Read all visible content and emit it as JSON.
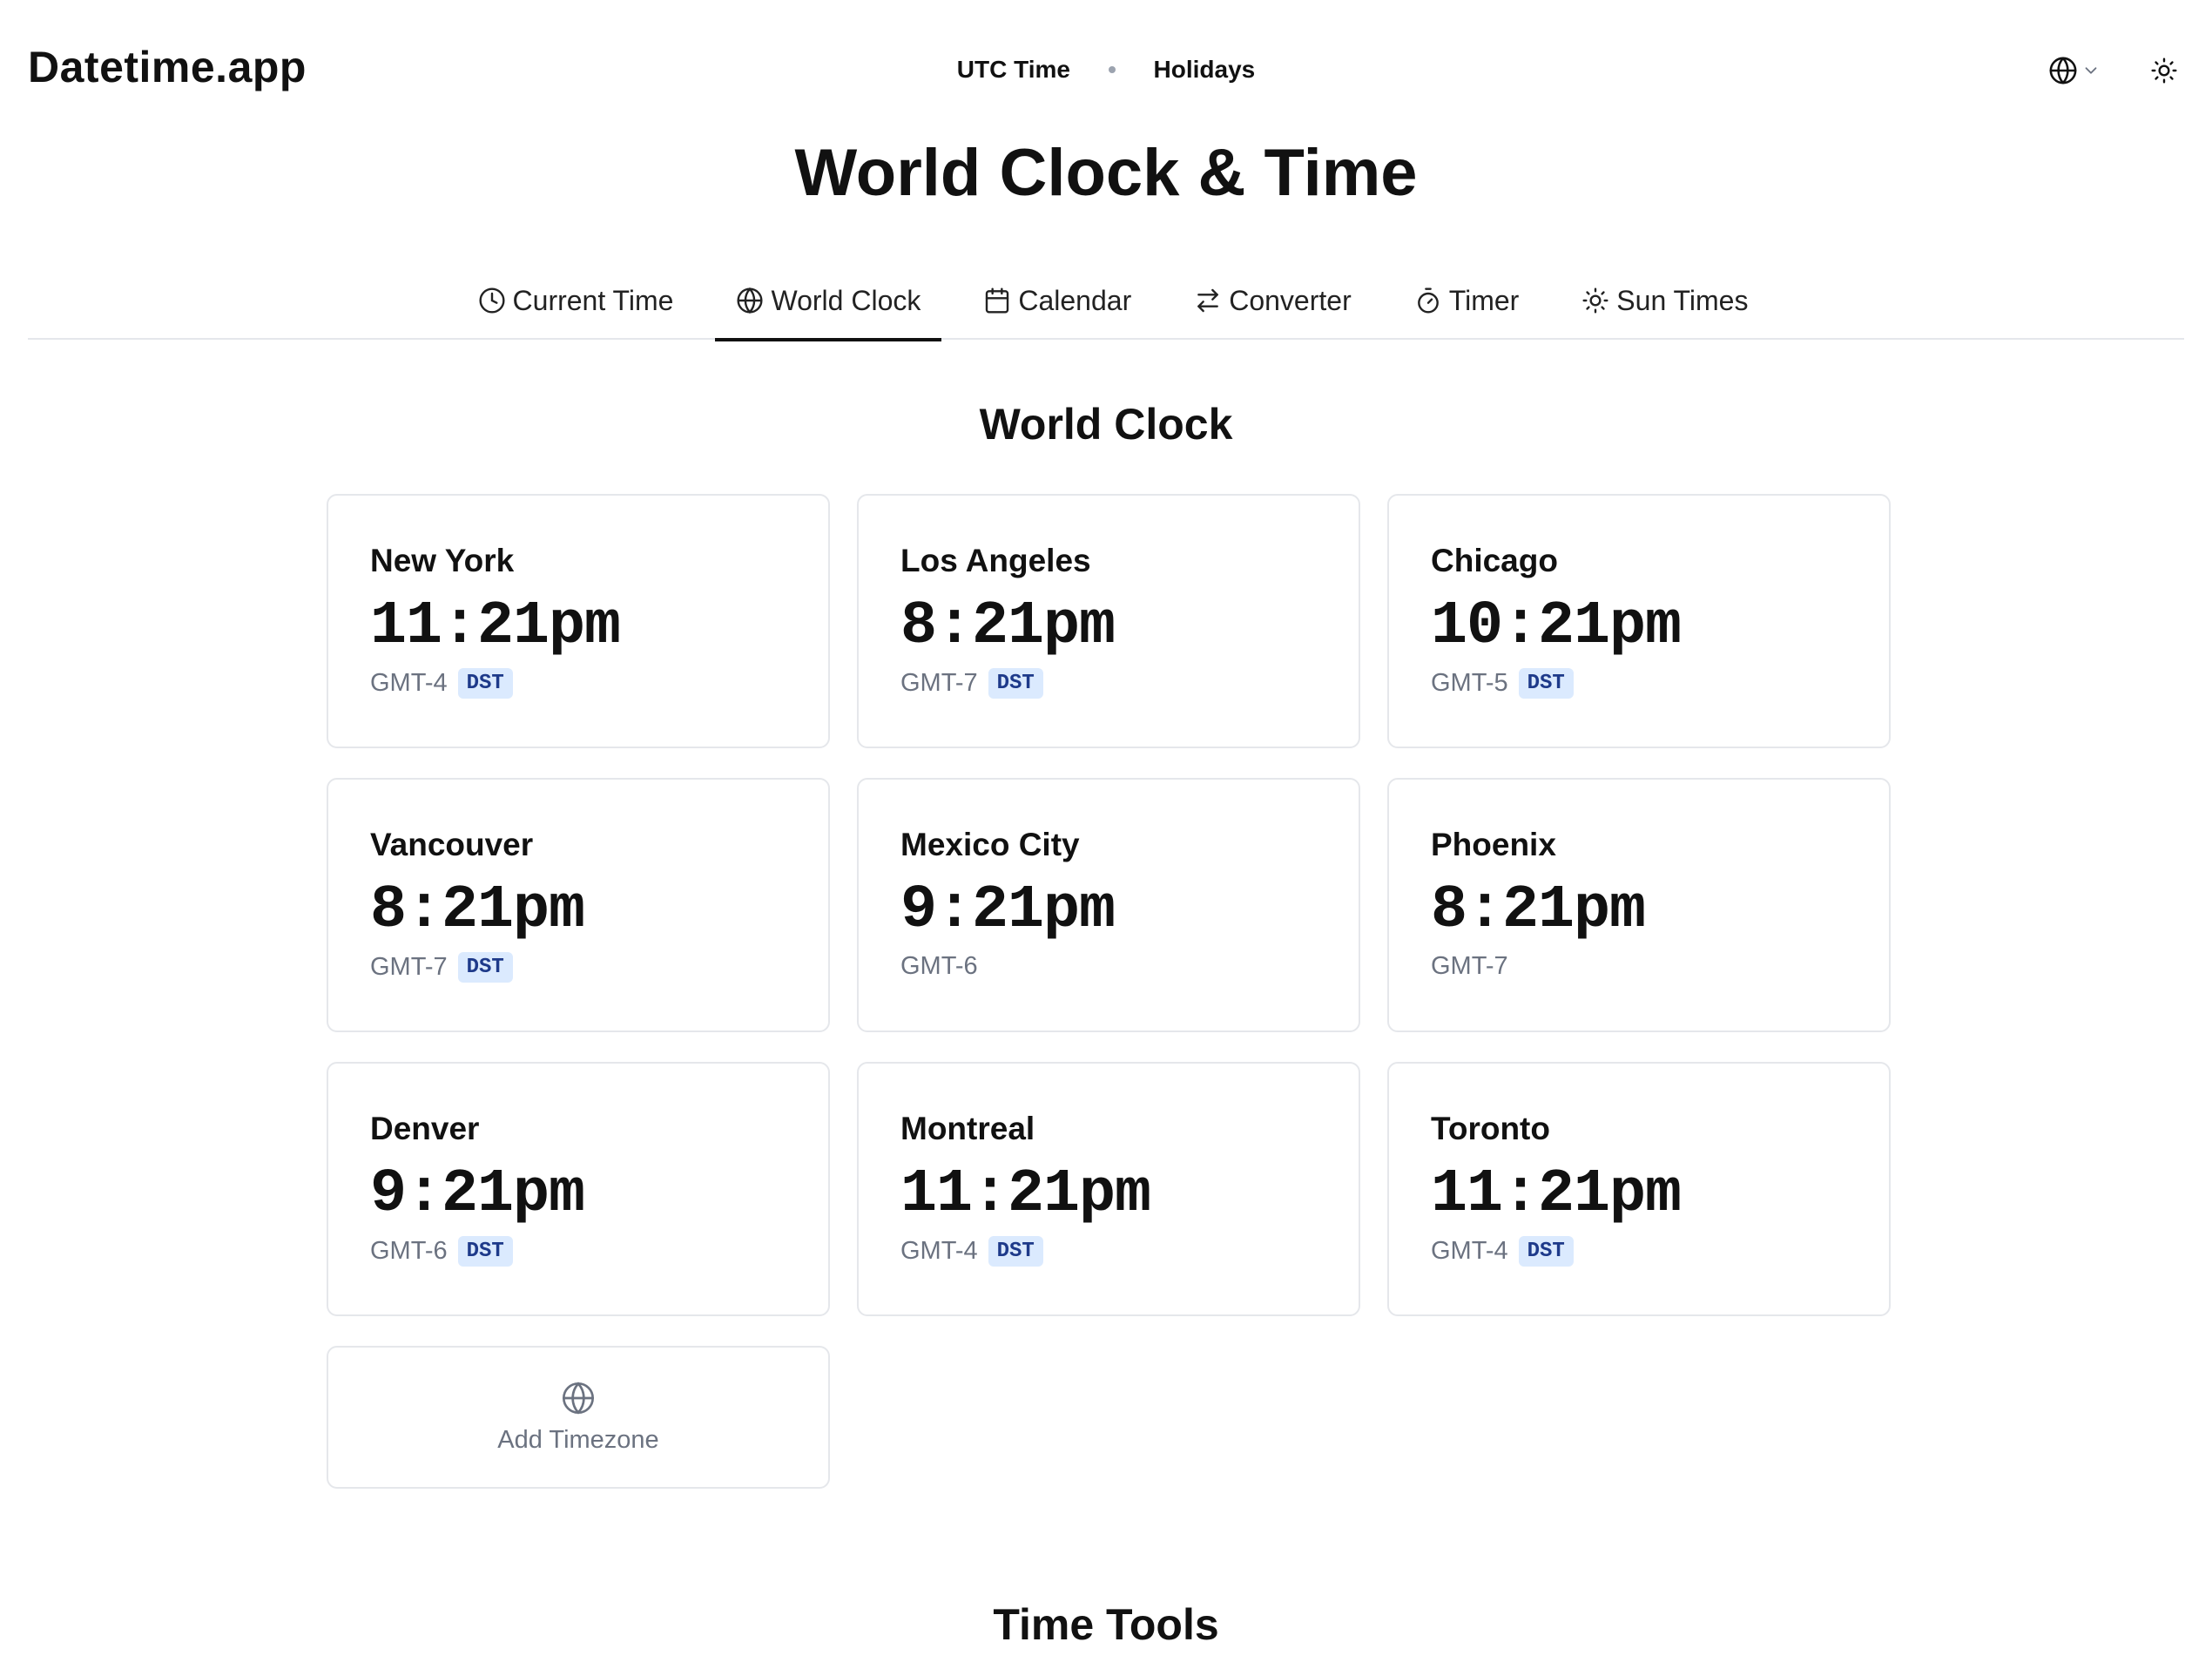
{
  "header": {
    "logo": "Datetime.app",
    "nav": [
      "UTC Time",
      "Holidays"
    ]
  },
  "page_title": "World Clock & Time",
  "tabs": [
    {
      "label": "Current Time",
      "icon": "clock-icon"
    },
    {
      "label": "World Clock",
      "icon": "globe-icon",
      "active": true
    },
    {
      "label": "Calendar",
      "icon": "calendar-icon"
    },
    {
      "label": "Converter",
      "icon": "swap-arrows-icon"
    },
    {
      "label": "Timer",
      "icon": "stopwatch-icon"
    },
    {
      "label": "Sun Times",
      "icon": "sun-icon"
    }
  ],
  "section_title": "World Clock",
  "clocks": [
    {
      "city": "New York",
      "time": "11:21pm",
      "gmt": "GMT-4",
      "dst": "DST"
    },
    {
      "city": "Los Angeles",
      "time": "8:21pm",
      "gmt": "GMT-7",
      "dst": "DST"
    },
    {
      "city": "Chicago",
      "time": "10:21pm",
      "gmt": "GMT-5",
      "dst": "DST"
    },
    {
      "city": "Vancouver",
      "time": "8:21pm",
      "gmt": "GMT-7",
      "dst": "DST"
    },
    {
      "city": "Mexico City",
      "time": "9:21pm",
      "gmt": "GMT-6",
      "dst": null
    },
    {
      "city": "Phoenix",
      "time": "8:21pm",
      "gmt": "GMT-7",
      "dst": null
    },
    {
      "city": "Denver",
      "time": "9:21pm",
      "gmt": "GMT-6",
      "dst": "DST"
    },
    {
      "city": "Montreal",
      "time": "11:21pm",
      "gmt": "GMT-4",
      "dst": "DST"
    },
    {
      "city": "Toronto",
      "time": "11:21pm",
      "gmt": "GMT-4",
      "dst": "DST"
    }
  ],
  "add_timezone_label": "Add Timezone",
  "tools_title": "Time Tools",
  "colors": {
    "text": "#111111",
    "muted": "#6b7280",
    "border": "#e5e7eb",
    "dst_bg": "#dbeafe",
    "dst_text": "#1e3a8a"
  }
}
